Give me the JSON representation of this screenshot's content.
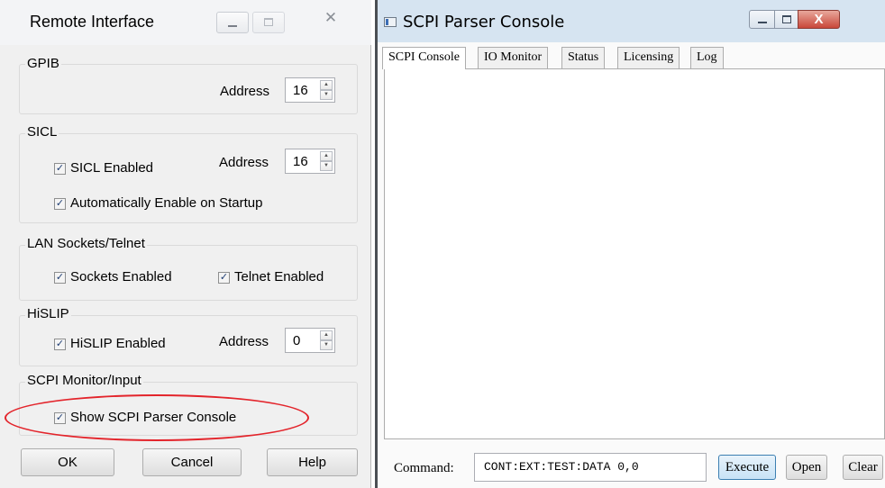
{
  "remote_interface": {
    "title": "Remote Interface",
    "gpib": {
      "label": "GPIB",
      "address_label": "Address",
      "address_value": "16"
    },
    "sicl": {
      "label": "SICL",
      "enabled_label": "SICL Enabled",
      "enabled_checked": true,
      "address_label": "Address",
      "address_value": "16",
      "auto_enable_label": "Automatically Enable on Startup",
      "auto_enable_checked": true
    },
    "lan": {
      "label": "LAN Sockets/Telnet",
      "sockets_label": "Sockets Enabled",
      "sockets_checked": true,
      "telnet_label": "Telnet Enabled",
      "telnet_checked": true
    },
    "hislip": {
      "label": "HiSLIP",
      "enabled_label": "HiSLIP Enabled",
      "enabled_checked": true,
      "address_label": "Address",
      "address_value": "0"
    },
    "scpi_monitor": {
      "label": "SCPI Monitor/Input",
      "show_console_label": "Show SCPI Parser Console",
      "show_console_checked": true
    },
    "buttons": {
      "ok": "OK",
      "cancel": "Cancel",
      "help": "Help"
    }
  },
  "scpi_console": {
    "title": "SCPI Parser Console",
    "tabs": [
      {
        "label": "SCPI Console",
        "active": true
      },
      {
        "label": "IO Monitor",
        "active": false
      },
      {
        "label": "Status",
        "active": false
      },
      {
        "label": "Licensing",
        "active": false
      },
      {
        "label": "Log",
        "active": false
      }
    ],
    "command_label": "Command:",
    "command_value": "CONT:EXT:TEST:DATA 0,0",
    "buttons": {
      "execute": "Execute",
      "open": "Open",
      "clear": "Clear"
    }
  },
  "icons": {
    "checkbox_check": "✓",
    "spin_up": "▲",
    "spin_down": "▼",
    "close_glyph": "✕",
    "close_glyph_large": "X"
  },
  "colors": {
    "highlight_ellipse": "#e3242b",
    "close_button": "#c9473a",
    "title_frame": "#d6e4f1"
  }
}
